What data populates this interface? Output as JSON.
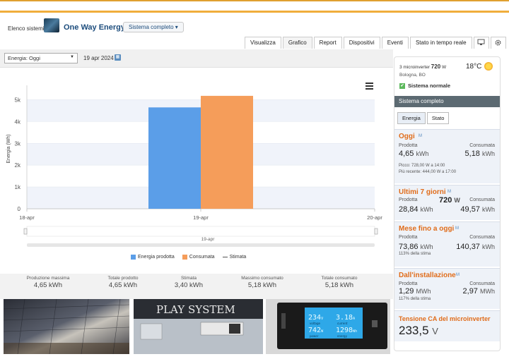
{
  "header": {
    "breadcrumb": "Elenco sistemi",
    "system_name": "One Way Energy",
    "system_dropdown": "Sistema completo ▾"
  },
  "tabs": [
    {
      "label": "Visualizza"
    },
    {
      "label": "Grafico"
    },
    {
      "label": "Report"
    },
    {
      "label": "Dispositivi"
    },
    {
      "label": "Eventi"
    },
    {
      "label": "Stato in tempo reale"
    }
  ],
  "toolbar": {
    "period_select": "Energia: Oggi",
    "date": "19 apr 2024",
    "calendar_glyph": "▦"
  },
  "chart_data": {
    "type": "bar",
    "title": "",
    "ylabel": "Energia (Wh)",
    "ylim": [
      0,
      5500
    ],
    "yticks": [
      {
        "value": 0,
        "label": "0"
      },
      {
        "value": 1000,
        "label": "1k"
      },
      {
        "value": 2000,
        "label": "2k"
      },
      {
        "value": 3000,
        "label": "3k"
      },
      {
        "value": 4000,
        "label": "4k"
      },
      {
        "value": 5000,
        "label": "5k"
      }
    ],
    "xticks": [
      {
        "value": "18-apr",
        "pos": 0
      },
      {
        "value": "19-apr",
        "pos": 0.5
      },
      {
        "value": "20-apr",
        "pos": 1
      }
    ],
    "category": "19-apr",
    "series": [
      {
        "name": "Energia prodotta",
        "value": 4650,
        "color": "#5b9ee8"
      },
      {
        "name": "Consumata",
        "value": 5180,
        "color": "#f59d5a"
      }
    ],
    "estimate_label": "Stimata",
    "navigator_label": "19-apr"
  },
  "stats": [
    {
      "label": "Produzione massima",
      "value": "4,65 kWh"
    },
    {
      "label": "Totale prodotto",
      "value": "4,65 kWh"
    },
    {
      "label": "Stimata",
      "value": "3,40 kWh"
    },
    {
      "label": "Massimo consumato",
      "value": "5,18 kWh"
    },
    {
      "label": "Totale consumato",
      "value": "5,18 kWh"
    }
  ],
  "photos": {
    "display_volt": "234",
    "display_volt_unit": "V",
    "display_amp": "3.18",
    "display_amp_unit": "A",
    "display_watt": "742",
    "display_watt_unit": "W",
    "display_energy": "1298",
    "display_energy_unit": "Wh",
    "label_voltage": "voltage",
    "label_current": "current",
    "label_power": "power",
    "label_energy": "energy",
    "brand_text": "PLAY SYSTEM"
  },
  "side": {
    "microinverter_prefix": "3 microinverter",
    "microinverter_power": "720",
    "microinverter_unit": "W",
    "location": "Bologna, BO",
    "temperature": "18°C",
    "status": "Sistema normale",
    "status_glyph": "✔",
    "section_title": "Sistema completo",
    "tabs": [
      {
        "label": "Energia"
      },
      {
        "label": "Stato"
      }
    ],
    "m_label": "M",
    "produced_label": "Prodotta",
    "consumed_label": "Consumata",
    "today": {
      "title": "Oggi",
      "produced": "4,65",
      "produced_unit": "kWh",
      "consumed": "5,18",
      "consumed_unit": "kWh",
      "peak": "Picco: 728,00 W a 14:00",
      "recent": "Più recente: 444,00 W a 17:00"
    },
    "last7": {
      "title": "Ultimi 7 giorni",
      "power": "720",
      "power_unit": "W",
      "produced": "28,84",
      "produced_unit": "kWh",
      "consumed": "49,57",
      "consumed_unit": "kWh"
    },
    "month": {
      "title": "Mese fino a oggi",
      "produced": "73,86",
      "produced_unit": "kWh",
      "consumed": "140,37",
      "consumed_unit": "kWh",
      "note": "113% della stima"
    },
    "install": {
      "title": "Dall'installazione",
      "produced": "1,29",
      "produced_unit": "MWh",
      "consumed": "2,97",
      "consumed_unit": "MWh",
      "note": "117% della stima"
    },
    "tension": {
      "title": "Tensione CA del microinverter",
      "value": "233,5",
      "unit": "V"
    }
  }
}
